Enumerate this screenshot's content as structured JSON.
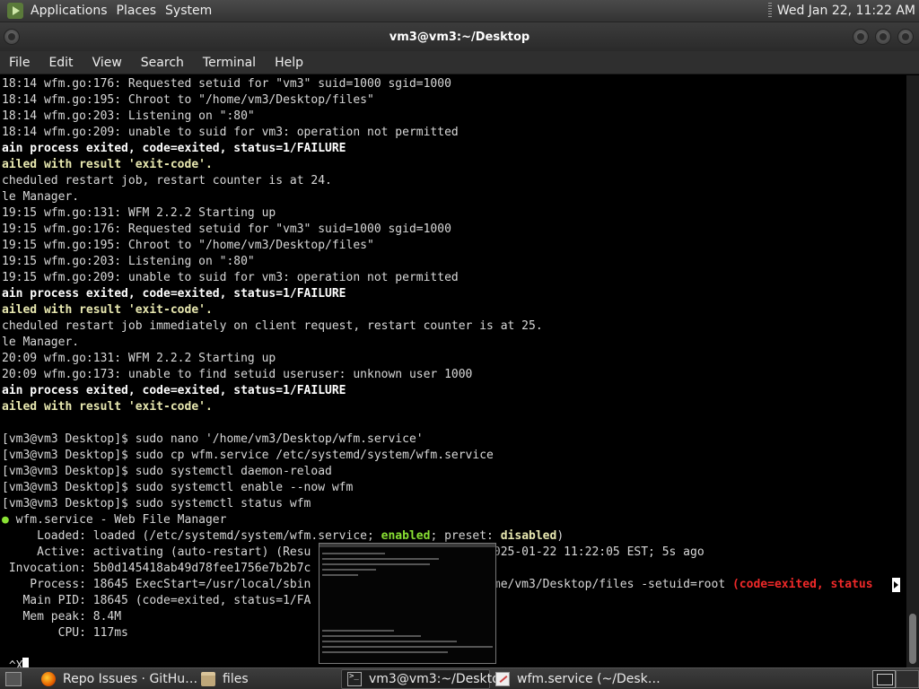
{
  "top_panel": {
    "menus": [
      "Applications",
      "Places",
      "System"
    ],
    "clock": "Wed Jan 22, 11:22 AM"
  },
  "window": {
    "title": "vm3@vm3:~/Desktop"
  },
  "menubar": [
    "File",
    "Edit",
    "View",
    "Search",
    "Terminal",
    "Help"
  ],
  "terminal": {
    "lines": [
      {
        "segments": [
          {
            "t": "18:14 wfm.go:176: Requested setuid for \"vm3\" suid=1000 sgid=1000",
            "c": ""
          }
        ]
      },
      {
        "segments": [
          {
            "t": "18:14 wfm.go:195: Chroot to \"/home/vm3/Desktop/files\"",
            "c": ""
          }
        ]
      },
      {
        "segments": [
          {
            "t": "18:14 wfm.go:203: Listening on \":80\"",
            "c": ""
          }
        ]
      },
      {
        "segments": [
          {
            "t": "18:14 wfm.go:209: unable to suid for vm3: operation not permitted",
            "c": ""
          }
        ]
      },
      {
        "segments": [
          {
            "t": "ain process exited, code=exited, status=1/FAILURE",
            "c": "b"
          }
        ]
      },
      {
        "segments": [
          {
            "t": "ailed with result 'exit-code'.",
            "c": "y"
          }
        ]
      },
      {
        "segments": [
          {
            "t": "cheduled restart job, restart counter is at 24.",
            "c": ""
          }
        ]
      },
      {
        "segments": [
          {
            "t": "le Manager.",
            "c": ""
          }
        ]
      },
      {
        "segments": [
          {
            "t": "19:15 wfm.go:131: WFM 2.2.2 Starting up",
            "c": ""
          }
        ]
      },
      {
        "segments": [
          {
            "t": "19:15 wfm.go:176: Requested setuid for \"vm3\" suid=1000 sgid=1000",
            "c": ""
          }
        ]
      },
      {
        "segments": [
          {
            "t": "19:15 wfm.go:195: Chroot to \"/home/vm3/Desktop/files\"",
            "c": ""
          }
        ]
      },
      {
        "segments": [
          {
            "t": "19:15 wfm.go:203: Listening on \":80\"",
            "c": ""
          }
        ]
      },
      {
        "segments": [
          {
            "t": "19:15 wfm.go:209: unable to suid for vm3: operation not permitted",
            "c": ""
          }
        ]
      },
      {
        "segments": [
          {
            "t": "ain process exited, code=exited, status=1/FAILURE",
            "c": "b"
          }
        ]
      },
      {
        "segments": [
          {
            "t": "ailed with result 'exit-code'.",
            "c": "y"
          }
        ]
      },
      {
        "segments": [
          {
            "t": "cheduled restart job immediately on client request, restart counter is at 25.",
            "c": ""
          }
        ]
      },
      {
        "segments": [
          {
            "t": "le Manager.",
            "c": ""
          }
        ]
      },
      {
        "segments": [
          {
            "t": "20:09 wfm.go:131: WFM 2.2.2 Starting up",
            "c": ""
          }
        ]
      },
      {
        "segments": [
          {
            "t": "20:09 wfm.go:173: unable to find setuid useruser: unknown user 1000",
            "c": ""
          }
        ]
      },
      {
        "segments": [
          {
            "t": "ain process exited, code=exited, status=1/FAILURE",
            "c": "b"
          }
        ]
      },
      {
        "segments": [
          {
            "t": "ailed with result 'exit-code'.",
            "c": "y"
          }
        ]
      },
      {
        "segments": [
          {
            "t": "",
            "c": ""
          }
        ]
      },
      {
        "segments": [
          {
            "t": "[vm3@vm3 Desktop]$ sudo nano '/home/vm3/Desktop/wfm.service'",
            "c": ""
          }
        ]
      },
      {
        "segments": [
          {
            "t": "[vm3@vm3 Desktop]$ sudo cp wfm.service /etc/systemd/system/wfm.service",
            "c": ""
          }
        ]
      },
      {
        "segments": [
          {
            "t": "[vm3@vm3 Desktop]$ sudo systemctl daemon-reload",
            "c": ""
          }
        ]
      },
      {
        "segments": [
          {
            "t": "[vm3@vm3 Desktop]$ sudo systemctl enable --now wfm",
            "c": ""
          }
        ]
      },
      {
        "segments": [
          {
            "t": "[vm3@vm3 Desktop]$ sudo systemctl status wfm",
            "c": ""
          }
        ]
      },
      {
        "segments": [
          {
            "t": "● ",
            "c": "ind"
          },
          {
            "t": "wfm.service - Web File Manager",
            "c": ""
          }
        ]
      },
      {
        "segments": [
          {
            "t": "     Loaded: loaded (/etc/systemd/system/wfm.service; ",
            "c": ""
          },
          {
            "t": "enabled",
            "c": "g"
          },
          {
            "t": "; preset: ",
            "c": ""
          },
          {
            "t": "disabled",
            "c": "y"
          },
          {
            "t": ")",
            "c": ""
          }
        ]
      },
      {
        "segments": [
          {
            "t": "     Active: activating (auto-restart) (Resu                         2025-01-22 11:22:05 EST; 5s ago",
            "c": ""
          }
        ]
      },
      {
        "segments": [
          {
            "t": " Invocation: 5b0d145418ab49d78fee1756e7b2b7c",
            "c": ""
          }
        ]
      },
      {
        "segments": [
          {
            "t": "    Process: 18645 ExecStart=/usr/local/sbin                         ome/vm3/Desktop/files -setuid=root ",
            "c": ""
          },
          {
            "t": "(code=exited, status",
            "c": "r"
          }
        ]
      },
      {
        "segments": [
          {
            "t": "   Main PID: 18645 (code=exited, status=1/FA",
            "c": ""
          }
        ]
      },
      {
        "segments": [
          {
            "t": "   Mem peak: 8.4M",
            "c": ""
          }
        ]
      },
      {
        "segments": [
          {
            "t": "        CPU: 117ms",
            "c": ""
          }
        ]
      },
      {
        "segments": [
          {
            "t": "",
            "c": ""
          }
        ]
      },
      {
        "segments": [
          {
            "t": " ^X",
            "c": ""
          }
        ]
      }
    ]
  },
  "taskbar": {
    "tasks": [
      {
        "label": "Repo Issues · GitHu…",
        "icon": "firefox-icon",
        "active": false
      },
      {
        "label": "files",
        "icon": "folder-icon",
        "active": false
      },
      {
        "label": "vm3@vm3:~/Desktop",
        "icon": "terminal-icon",
        "active": true
      },
      {
        "label": "wfm.service (~/Desk…",
        "icon": "editor-icon",
        "active": false
      }
    ]
  },
  "colors": {
    "green": "#8ae234",
    "red": "#ef2929",
    "yellow": "#e8e8b0"
  }
}
